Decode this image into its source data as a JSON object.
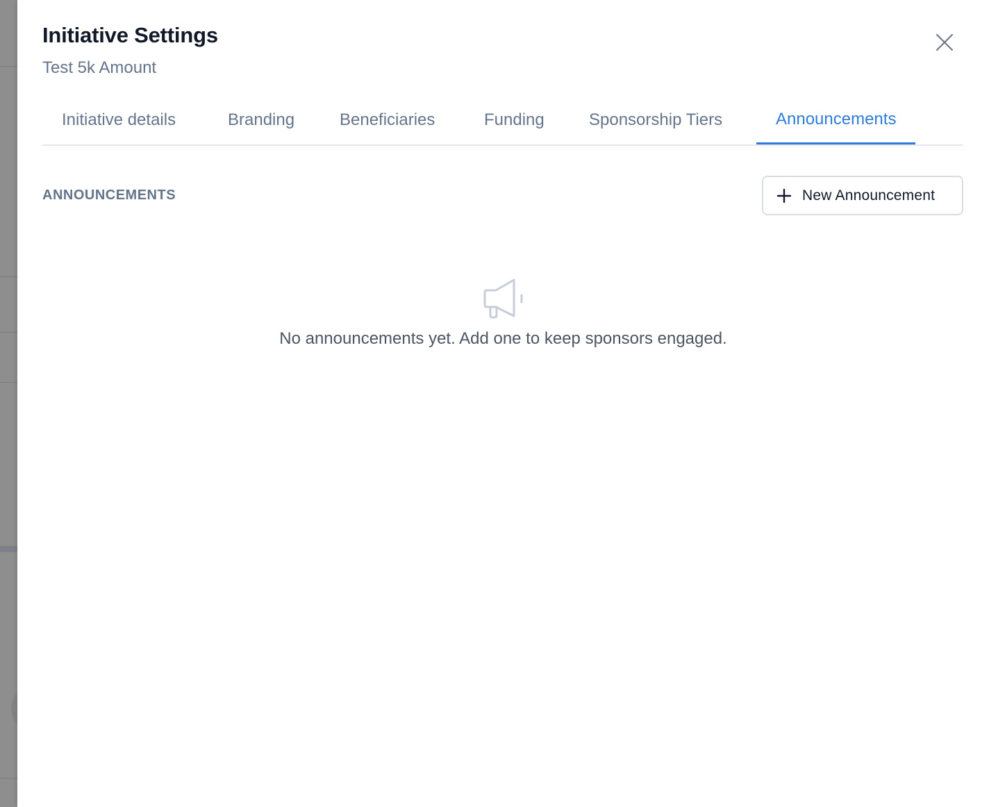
{
  "dialog": {
    "title": "Initiative Settings",
    "subtitle": "Test 5k Amount"
  },
  "tabs": [
    {
      "label": "Initiative details",
      "active": false
    },
    {
      "label": "Branding",
      "active": false
    },
    {
      "label": "Beneficiaries",
      "active": false
    },
    {
      "label": "Funding",
      "active": false
    },
    {
      "label": "Sponsorship Tiers",
      "active": false
    },
    {
      "label": "Announcements",
      "active": true
    }
  ],
  "section": {
    "label": "ANNOUNCEMENTS",
    "new_button_label": "New Announcement"
  },
  "empty_state": {
    "icon": "megaphone-icon",
    "message": "No announcements yet. Add one to keep sponsors engaged."
  },
  "colors": {
    "accent": "#2f7bd8",
    "muted_text": "#64748b",
    "heading": "#111827"
  }
}
